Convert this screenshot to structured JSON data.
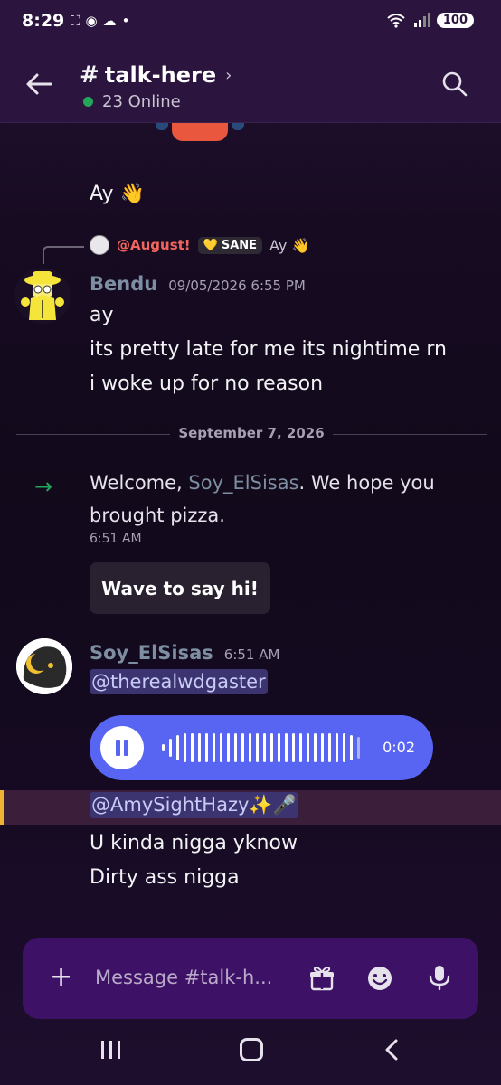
{
  "status_bar": {
    "time": "8:29",
    "battery": "100",
    "signal_badge": "6"
  },
  "header": {
    "channel_prefix": "#",
    "channel_name": "talk-here",
    "online_text": "23 Online"
  },
  "messages_top": {
    "ay_text": "Ay",
    "ay_emoji": "👋"
  },
  "reply": {
    "name": "@August!",
    "badge": "SANE",
    "badge_icon": "💛",
    "text": "Ay",
    "emoji": "👋"
  },
  "bendu": {
    "author": "Bendu",
    "timestamp": "09/05/2026 6:55 PM",
    "lines": [
      "ay",
      "its pretty late for me its nightime rn",
      "i woke up for no reason"
    ]
  },
  "divider": {
    "date": "September 7, 2026"
  },
  "welcome": {
    "prefix": "Welcome, ",
    "user": "Soy_ElSisas",
    "suffix": ". We hope you brought pizza.",
    "time": "6:51 AM",
    "wave_button": "Wave to say hi!"
  },
  "soy": {
    "author": "Soy_ElSisas",
    "timestamp": "6:51 AM",
    "mention1": "@therealwdgaster",
    "voice_duration": "0:02",
    "mention2": "@AmySightHazy✨🎤",
    "lines": [
      "U kinda nigga yknow",
      "Dirty ass nigga"
    ]
  },
  "composer": {
    "placeholder": "Message #talk-h..."
  },
  "colors": {
    "accent": "#5865f2",
    "online": "#23a55a",
    "reply_name": "#f2655d",
    "highlight": "#f0b232"
  },
  "icons": [
    "back-arrow-icon",
    "search-icon",
    "plus-icon",
    "gift-icon",
    "emoji-icon",
    "mic-icon",
    "pause-icon",
    "join-arrow-icon"
  ]
}
